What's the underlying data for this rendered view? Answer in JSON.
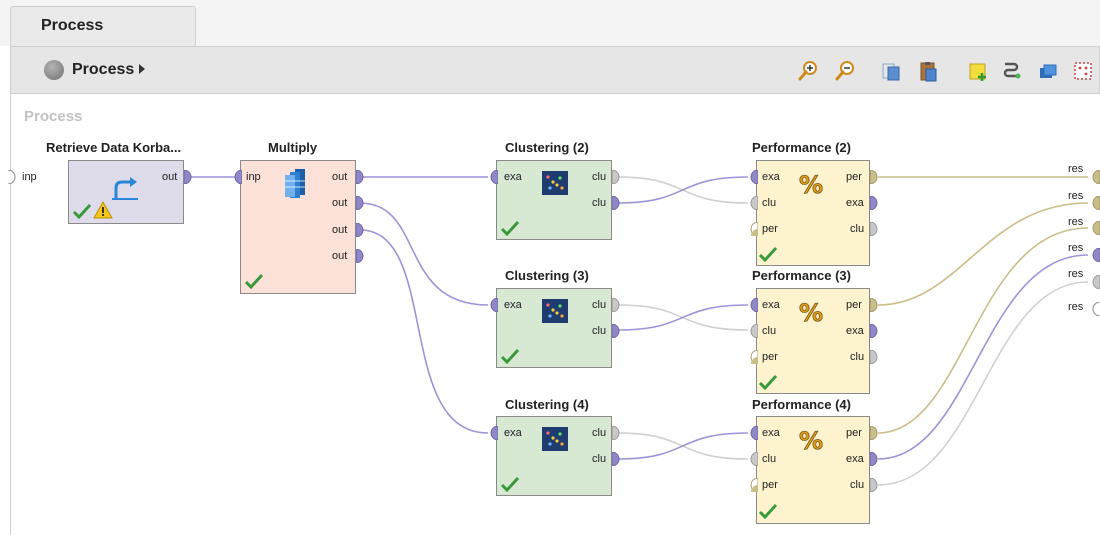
{
  "tab": {
    "label": "Process"
  },
  "breadcrumb": {
    "label": "Process"
  },
  "toolbar": {
    "icons": [
      "zoom-in-icon",
      "zoom-out-icon",
      "copy-icon",
      "paste-icon",
      "add-note-icon",
      "auto-wire-icon",
      "layers-icon",
      "fit-view-icon"
    ]
  },
  "canvas": {
    "title": "Process"
  },
  "process_ports": {
    "input": "inp",
    "results": [
      "res",
      "res",
      "res",
      "res",
      "res",
      "res"
    ]
  },
  "operators": {
    "retrieve": {
      "name": "Retrieve Data Korba...",
      "out": "out"
    },
    "multiply": {
      "name": "Multiply",
      "in": "inp",
      "outs": [
        "out",
        "out",
        "out",
        "out"
      ]
    },
    "clustering": [
      {
        "name": "Clustering (2)",
        "in": "exa",
        "outs": [
          "clu",
          "clu"
        ]
      },
      {
        "name": "Clustering (3)",
        "in": "exa",
        "outs": [
          "clu",
          "clu"
        ]
      },
      {
        "name": "Clustering (4)",
        "in": "exa",
        "outs": [
          "clu",
          "clu"
        ]
      }
    ],
    "performance": [
      {
        "name": "Performance (2)",
        "ins": [
          "exa",
          "clu",
          "per"
        ],
        "outs": [
          "per",
          "exa",
          "clu"
        ]
      },
      {
        "name": "Performance (3)",
        "ins": [
          "exa",
          "clu",
          "per"
        ],
        "outs": [
          "per",
          "exa",
          "clu"
        ]
      },
      {
        "name": "Performance (4)",
        "ins": [
          "exa",
          "clu",
          "per"
        ],
        "outs": [
          "per",
          "exa",
          "clu"
        ]
      }
    ]
  },
  "colors": {
    "wire_example": "#9a94d8",
    "wire_cluster": "#d0d0d0",
    "wire_perf": "#c9bd88",
    "port_example": "#8f87c8",
    "port_cluster": "#bdbdbd",
    "port_perf": "#c9bd88"
  }
}
